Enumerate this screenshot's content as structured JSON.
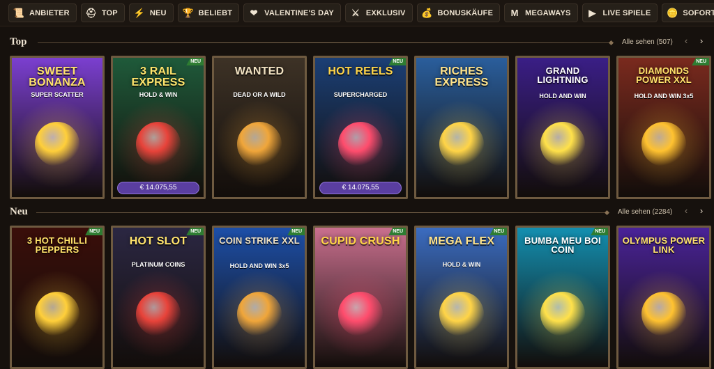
{
  "nav": [
    {
      "label": "ANBIETER",
      "icon": "scroll-icon",
      "glyph": "📜"
    },
    {
      "label": "TOP",
      "icon": "helmet-icon",
      "glyph": "⛑"
    },
    {
      "label": "NEU",
      "icon": "lightning-icon",
      "glyph": "⚡"
    },
    {
      "label": "BELIEBT",
      "icon": "trophy-icon",
      "glyph": "🏆"
    },
    {
      "label": "VALENTINE'S DAY",
      "icon": "heart-icon",
      "glyph": "❤"
    },
    {
      "label": "EXKLUSIV",
      "icon": "crossed-swords-icon",
      "glyph": "⚔"
    },
    {
      "label": "BONUSKÄUFE",
      "icon": "money-bag-icon",
      "glyph": "💰"
    },
    {
      "label": "MEGAWAYS",
      "icon": "megaways-m-icon",
      "glyph": "M"
    },
    {
      "label": "LIVE SPIELE",
      "icon": "play-icon",
      "glyph": "▶"
    },
    {
      "label": "SOFORT-SPIELE",
      "icon": "coin-stack-icon",
      "glyph": "🪙"
    }
  ],
  "sections": {
    "top": {
      "title": "Top",
      "see_all": "Alle sehen (507)",
      "games": [
        {
          "title": "SWEET BONANZA",
          "sub": "SUPER SCATTER",
          "neu": "",
          "jackpot": "",
          "bg": "#7b3fd0"
        },
        {
          "title": "3 RAIL EXPRESS",
          "sub": "HOLD & WIN",
          "neu": "NEU",
          "jackpot": "€ 14.075,55",
          "bg": "#1f5a3a"
        },
        {
          "title": "WANTED",
          "sub": "DEAD OR A WILD",
          "neu": "",
          "jackpot": "",
          "bg": "#3d3226"
        },
        {
          "title": "HOT REELS",
          "sub": "SUPERCHARGED",
          "neu": "NEU",
          "jackpot": "€ 14.075,55",
          "bg": "#1b3f75"
        },
        {
          "title": "RICHES EXPRESS",
          "sub": "",
          "neu": "",
          "jackpot": "",
          "bg": "#2a5e9c"
        },
        {
          "title": "GRAND LIGHTNING",
          "sub": "HOLD AND WIN",
          "neu": "",
          "jackpot": "",
          "bg": "#3a1e86"
        },
        {
          "title": "DIAMONDS POWER XXL",
          "sub": "HOLD AND WIN 3x5",
          "neu": "NEU",
          "jackpot": "",
          "bg": "#7a2a1e"
        }
      ]
    },
    "neu": {
      "title": "Neu",
      "see_all": "Alle sehen (2284)",
      "games": [
        {
          "title": "3 HOT CHILLI PEPPERS",
          "sub": "",
          "neu": "NEU",
          "jackpot": "",
          "bg": "#3a0e0a"
        },
        {
          "title": "HOT SLOT",
          "sub": "PLATINUM COINS",
          "neu": "NEU",
          "jackpot": "",
          "bg": "#2b2742"
        },
        {
          "title": "COIN STRIKE XXL",
          "sub": "HOLD AND WIN 3x5",
          "neu": "NEU",
          "jackpot": "",
          "bg": "#1d4fa8"
        },
        {
          "title": "CUPID CRUSH",
          "sub": "",
          "neu": "NEU",
          "jackpot": "",
          "bg": "#c96f8e"
        },
        {
          "title": "MEGA FLEX",
          "sub": "HOLD & WIN",
          "neu": "NEU",
          "jackpot": "",
          "bg": "#3b6cc0"
        },
        {
          "title": "BUMBA MEU BOI COIN",
          "sub": "",
          "neu": "NEU",
          "jackpot": "",
          "bg": "#138fb0"
        },
        {
          "title": "OLYMPUS POWER LINK",
          "sub": "",
          "neu": "",
          "jackpot": "",
          "bg": "#4a2398"
        }
      ]
    }
  },
  "arrows": {
    "prev": "‹",
    "next": "›"
  }
}
